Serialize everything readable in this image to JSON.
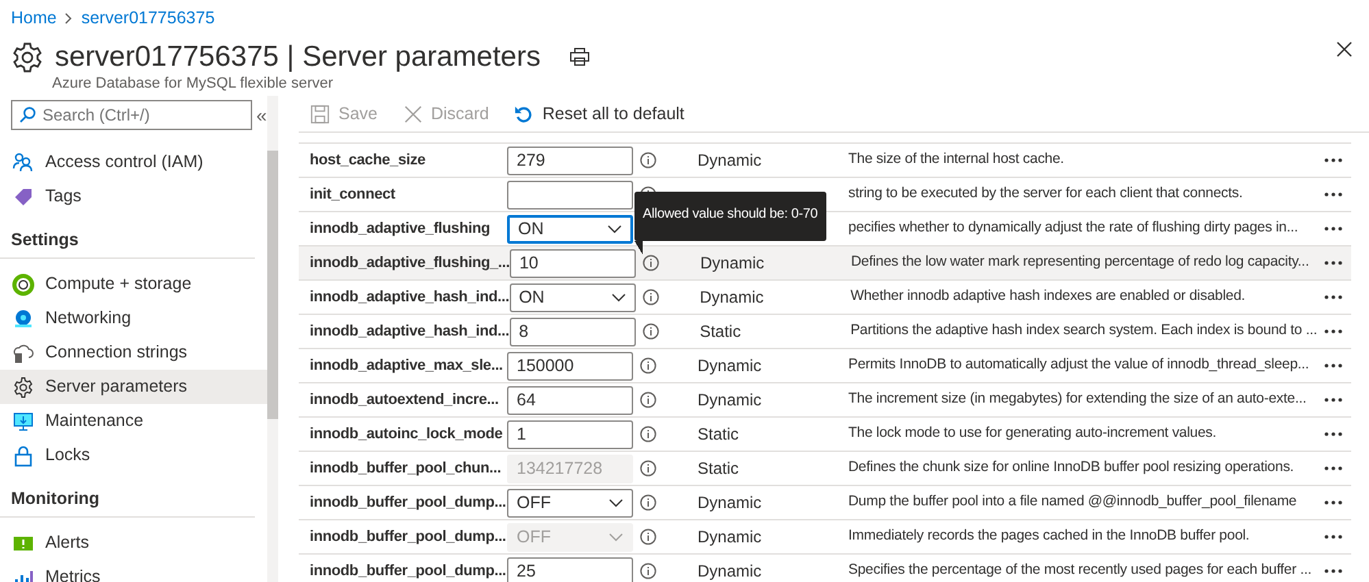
{
  "breadcrumb": [
    {
      "label": "Home"
    },
    {
      "label": "server017756375"
    }
  ],
  "header": {
    "title": "server017756375 | Server parameters",
    "subtitle": "Azure Database for MySQL flexible server"
  },
  "sidebar": {
    "search": {
      "placeholder": "Search (Ctrl+/)"
    },
    "collapse": "«",
    "sections": [
      {
        "items": [
          {
            "label": "Access control (IAM)",
            "selected": false
          },
          {
            "label": "Tags",
            "selected": false
          }
        ]
      },
      {
        "heading": "Settings",
        "items": [
          {
            "label": "Compute + storage",
            "selected": false
          },
          {
            "label": "Networking",
            "selected": false
          },
          {
            "label": "Connection strings",
            "selected": false
          },
          {
            "label": "Server parameters",
            "selected": true
          },
          {
            "label": "Maintenance",
            "selected": false
          },
          {
            "label": "Locks",
            "selected": false
          }
        ]
      },
      {
        "heading": "Monitoring",
        "items": [
          {
            "label": "Alerts",
            "selected": false
          },
          {
            "label": "Metrics",
            "selected": false
          }
        ]
      }
    ]
  },
  "toolbar": [
    {
      "label": "Save",
      "disabled": true
    },
    {
      "label": "Discard",
      "disabled": true
    },
    {
      "label": "Reset all to default",
      "disabled": false
    }
  ],
  "tooltip": {
    "text": "Allowed value should be: 0-70"
  },
  "parameters": [
    {
      "name": "host_cache_size",
      "kind": "text",
      "value": "279",
      "disabled": false,
      "focused": false,
      "selected": false,
      "type": "Dynamic",
      "description": "The size of the internal host cache."
    },
    {
      "name": "init_connect",
      "kind": "text",
      "disabled": false,
      "focused": false,
      "selected": false,
      "description": "string to be executed by the server for each client that connects."
    },
    {
      "name": "innodb_adaptive_flushing",
      "kind": "select",
      "value": "ON",
      "disabled": false,
      "focused": true,
      "selected": false,
      "description": "pecifies whether to dynamically adjust the rate of flushing dirty pages in..."
    },
    {
      "name": "innodb_adaptive_flushing_...",
      "kind": "text",
      "value": "10",
      "disabled": false,
      "focused": false,
      "selected": true,
      "type": "Dynamic",
      "description": "Defines the low water mark representing percentage of redo log capacity..."
    },
    {
      "name": "innodb_adaptive_hash_ind...",
      "kind": "select",
      "value": "ON",
      "disabled": false,
      "focused": false,
      "selected": false,
      "type": "Dynamic",
      "description": "Whether innodb adaptive hash indexes are enabled or disabled."
    },
    {
      "name": "innodb_adaptive_hash_ind...",
      "kind": "text",
      "value": "8",
      "disabled": false,
      "focused": false,
      "selected": false,
      "type": "Static",
      "description": "Partitions the adaptive hash index search system. Each index is bound to ..."
    },
    {
      "name": "innodb_adaptive_max_sle...",
      "kind": "text",
      "value": "150000",
      "disabled": false,
      "focused": false,
      "selected": false,
      "type": "Dynamic",
      "description": "Permits InnoDB to automatically adjust the value of innodb_thread_sleep..."
    },
    {
      "name": "innodb_autoextend_incre...",
      "kind": "text",
      "value": "64",
      "disabled": false,
      "focused": false,
      "selected": false,
      "type": "Dynamic",
      "description": "The increment size (in megabytes) for extending the size of an auto-exte..."
    },
    {
      "name": "innodb_autoinc_lock_mode",
      "kind": "text",
      "value": "1",
      "disabled": false,
      "focused": false,
      "selected": false,
      "type": "Static",
      "description": "The lock mode to use for generating auto-increment values."
    },
    {
      "name": "innodb_buffer_pool_chun...",
      "kind": "text",
      "value": "134217728",
      "disabled": true,
      "focused": false,
      "selected": false,
      "type": "Static",
      "description": "Defines the chunk size for online InnoDB buffer pool resizing operations."
    },
    {
      "name": "innodb_buffer_pool_dump...",
      "kind": "select",
      "value": "OFF",
      "disabled": false,
      "focused": false,
      "selected": false,
      "type": "Dynamic",
      "description": "Dump the buffer pool into a file named @@innodb_buffer_pool_filename"
    },
    {
      "name": "innodb_buffer_pool_dump...",
      "kind": "select",
      "value": "OFF",
      "disabled": true,
      "focused": false,
      "selected": false,
      "type": "Dynamic",
      "description": "Immediately records the pages cached in the InnoDB buffer pool."
    },
    {
      "name": "innodb_buffer_pool_dump...",
      "kind": "text",
      "value": "25",
      "disabled": false,
      "focused": false,
      "selected": false,
      "type": "Dynamic",
      "description": "Specifies the percentage of the most recently used pages for each buffer ..."
    }
  ]
}
